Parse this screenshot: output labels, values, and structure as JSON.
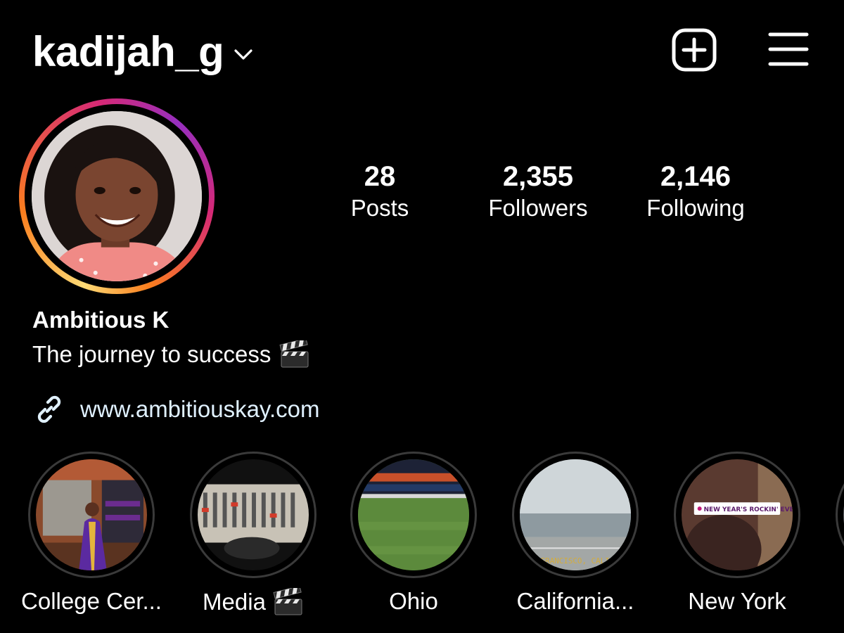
{
  "header": {
    "username": "kadijah_g",
    "icons": {
      "chevron": "chevron-down-icon",
      "new_post": "plus-square-icon",
      "menu": "hamburger-menu-icon"
    }
  },
  "profile": {
    "avatar_icon": "profile-photo"
  },
  "stats": [
    {
      "count": "28",
      "label": "Posts"
    },
    {
      "count": "2,355",
      "label": "Followers"
    },
    {
      "count": "2,146",
      "label": "Following"
    }
  ],
  "bio": {
    "display_name": "Ambitious K",
    "text": "The journey to success",
    "emoji": "clapper-board-emoji",
    "link": "www.ambitiouskay.com",
    "link_icon": "link-icon"
  },
  "highlights": [
    {
      "label": "College Cer...",
      "image": "graduation-photo"
    },
    {
      "label": "Media",
      "emoji": "clapper-board-emoji",
      "image": "mixing-console-photo"
    },
    {
      "label": "Ohio",
      "image": "stadium-field-photo"
    },
    {
      "label": "California...",
      "image": "bay-view-photo",
      "overlay_text": "FRANCISCO, CALIFO"
    },
    {
      "label": "New York",
      "image": "nye-selfie-photo",
      "overlay_text": "NEW YEAR'S ROCKIN' EVE"
    }
  ],
  "colors": {
    "background": "#000000",
    "text": "#ffffff",
    "link": "#e0f1ff",
    "ring_gradient": [
      "#feda75",
      "#fa7e1e",
      "#d62976",
      "#962fbf"
    ],
    "highlight_ring": "#3a3a3a"
  }
}
